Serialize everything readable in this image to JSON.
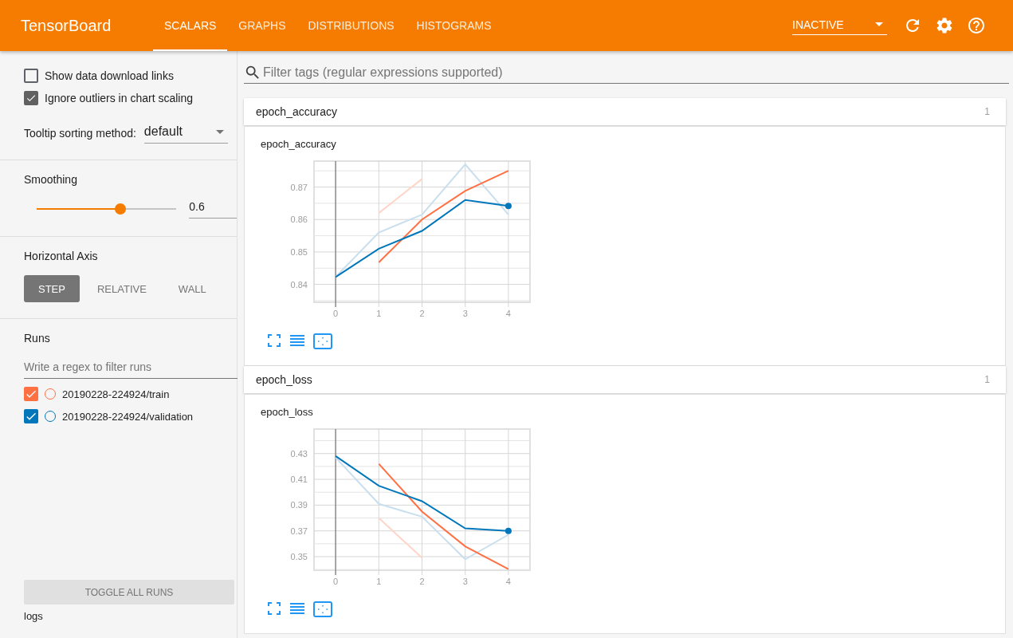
{
  "header": {
    "title": "TensorBoard",
    "tabs": [
      {
        "label": "SCALARS",
        "selected": true
      },
      {
        "label": "GRAPHS",
        "selected": false
      },
      {
        "label": "DISTRIBUTIONS",
        "selected": false
      },
      {
        "label": "HISTOGRAMS",
        "selected": false
      }
    ],
    "run_selector": {
      "value": "INACTIVE"
    }
  },
  "sidebar": {
    "options": [
      {
        "label": "Show data download links",
        "checked": false
      },
      {
        "label": "Ignore outliers in chart scaling",
        "checked": true
      }
    ],
    "tooltip_sorting": {
      "label": "Tooltip sorting method:",
      "value": "default"
    },
    "smoothing": {
      "title": "Smoothing",
      "level": 0.6,
      "value": "0.6"
    },
    "horizontal_axis": {
      "title": "Horizontal Axis",
      "options": [
        {
          "label": "STEP",
          "selected": true
        },
        {
          "label": "RELATIVE",
          "selected": false
        },
        {
          "label": "WALL",
          "selected": false
        }
      ]
    },
    "runs": {
      "title": "Runs",
      "filter_placeholder": "Write a regex to filter runs",
      "items": [
        {
          "name": "20190228-224924/train",
          "checked": true,
          "color": "#ff7043"
        },
        {
          "name": "20190228-224924/validation",
          "checked": true,
          "color": "#0077bb"
        }
      ]
    },
    "toggle_button": "TOGGLE ALL RUNS",
    "logdir": "logs"
  },
  "main": {
    "filter_placeholder": "Filter tags (regular expressions supported)",
    "groups": [
      {
        "name": "epoch_accuracy",
        "count": "1",
        "charts": [
          {
            "title": "epoch_accuracy",
            "chart_data": {
              "type": "line",
              "grid": true,
              "x": [
                0,
                1,
                2,
                3,
                4
              ],
              "xlim": [
                -0.5,
                4.5
              ],
              "ylim": [
                0.8345,
                0.878
              ],
              "xticks": [
                0,
                1,
                2,
                3,
                4
              ],
              "yticks": [
                0.84,
                0.85,
                0.86,
                0.87
              ],
              "series": [
                {
                  "color": "#ffd5c8",
                  "values": [
                    null,
                    0.862,
                    0.8725,
                    null,
                    null
                  ]
                },
                {
                  "color": "#c9dfee",
                  "values": [
                    0.8423,
                    0.856,
                    0.8615,
                    0.877,
                    0.8615
                  ]
                },
                {
                  "color": "#ff7043",
                  "values": [
                    null,
                    0.8468,
                    0.86,
                    0.8688,
                    0.875
                  ]
                },
                {
                  "color": "#0077bb",
                  "values": [
                    0.8423,
                    0.851,
                    0.8565,
                    0.866,
                    0.8642
                  ]
                }
              ]
            }
          }
        ]
      },
      {
        "name": "epoch_loss",
        "count": "1",
        "charts": [
          {
            "title": "epoch_loss",
            "chart_data": {
              "type": "line",
              "grid": true,
              "x": [
                0,
                1,
                2,
                3,
                4
              ],
              "xlim": [
                -0.5,
                4.5
              ],
              "ylim": [
                0.3395,
                0.449
              ],
              "xticks": [
                0,
                1,
                2,
                3,
                4
              ],
              "yticks": [
                0.35,
                0.37,
                0.39,
                0.41,
                0.43
              ],
              "series": [
                {
                  "color": "#ffd5c8",
                  "values": [
                    null,
                    0.38,
                    0.349,
                    null,
                    null
                  ]
                },
                {
                  "color": "#c9dfee",
                  "values": [
                    0.427,
                    0.391,
                    0.381,
                    0.348,
                    0.367
                  ]
                },
                {
                  "color": "#ff7043",
                  "values": [
                    null,
                    0.422,
                    0.385,
                    0.358,
                    0.3403
                  ]
                },
                {
                  "color": "#0077bb",
                  "values": [
                    0.428,
                    0.405,
                    0.393,
                    0.372,
                    0.37
                  ]
                }
              ]
            }
          }
        ]
      }
    ]
  }
}
